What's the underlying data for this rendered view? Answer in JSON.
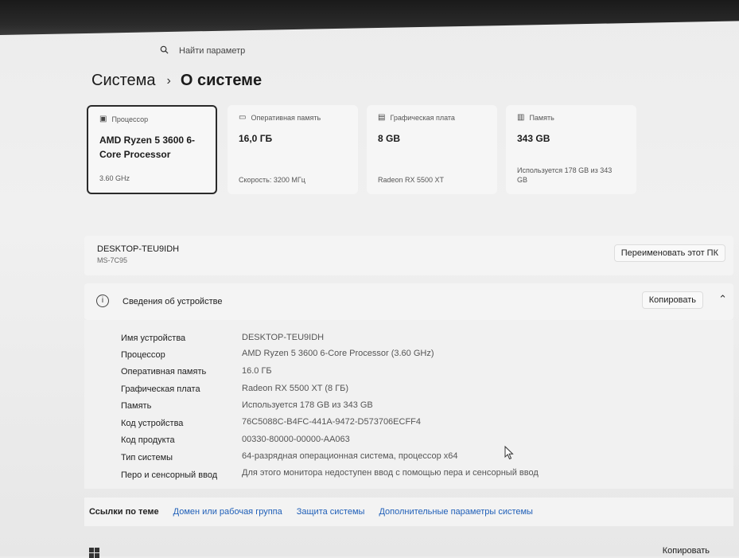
{
  "search": {
    "placeholder": "Найти параметр"
  },
  "breadcrumb": {
    "parent": "Система",
    "separator": "›",
    "current": "О системе"
  },
  "cards": [
    {
      "label": "Процессор",
      "value": "AMD Ryzen 5 3600 6-Core Processor",
      "sub": "3.60 GHz",
      "icon": "cpu-icon"
    },
    {
      "label": "Оперативная память",
      "value": "16,0 ГБ",
      "sub": "Скорость: 3200 МГц",
      "icon": "ram-icon"
    },
    {
      "label": "Графическая плата",
      "value": "8 GB",
      "sub": "Radeon RX 5500 XT",
      "icon": "gpu-icon"
    },
    {
      "label": "Память",
      "value": "343 GB",
      "sub": "Используется 178 GB из 343 GB",
      "icon": "storage-icon"
    }
  ],
  "device": {
    "name": "DESKTOP-TEU9IDH",
    "model": "MS-7C95",
    "rename_label": "Переименовать этот ПК"
  },
  "specs": {
    "title": "Сведения об устройстве",
    "copy_label": "Копировать",
    "rows": [
      {
        "label": "Имя устройства",
        "value": "DESKTOP-TEU9IDH"
      },
      {
        "label": "Процессор",
        "value": "AMD Ryzen 5 3600 6-Core Processor (3.60 GHz)"
      },
      {
        "label": "Оперативная память",
        "value": "16.0 ГБ"
      },
      {
        "label": "Графическая плата",
        "value": "Radeon RX 5500 XT (8 ГБ)"
      },
      {
        "label": "Память",
        "value": "Используется 178 GB из 343 GB"
      },
      {
        "label": "Код устройства",
        "value": "76C5088C-B4FC-441A-9472-D573706ECFF4"
      },
      {
        "label": "Код продукта",
        "value": "00330-80000-00000-AA063"
      },
      {
        "label": "Тип системы",
        "value": "64-разрядная операционная система, процессор x64"
      },
      {
        "label": "Перо и сенсорный ввод",
        "value": "Для этого монитора недоступен ввод с помощью пера и сенсорный ввод"
      }
    ]
  },
  "related": {
    "title": "Ссылки по теме",
    "links": [
      "Домен или рабочая группа",
      "Защита системы",
      "Дополнительные параметры системы"
    ]
  },
  "bottom": {
    "copy_label": "Копировать"
  }
}
